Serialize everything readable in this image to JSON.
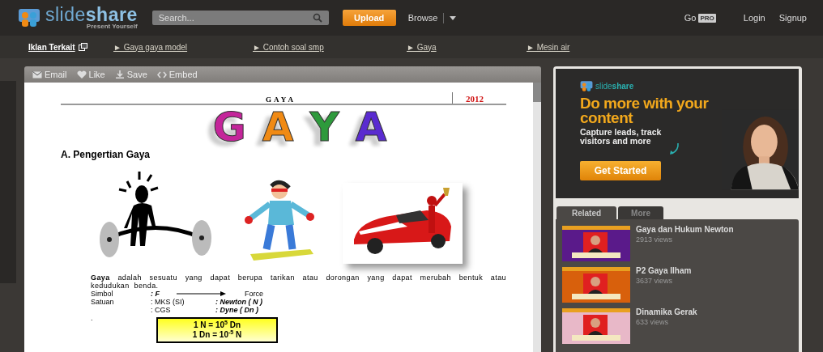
{
  "header": {
    "logo": {
      "part1": "slide",
      "part2": "share",
      "tagline": "Present Yourself"
    },
    "search": {
      "placeholder": "Search..."
    },
    "upload": "Upload",
    "browse": "Browse",
    "go": "Go",
    "pro": "PRO",
    "login": "Login",
    "signup": "Signup"
  },
  "ad_links": {
    "label": "Iklan Terkait",
    "links": [
      "► Gaya gaya model",
      "► Contoh soal smp",
      "► Gaya",
      "► Mesin air"
    ]
  },
  "toolbar": [
    "Email",
    "Like",
    "Save",
    "Embed"
  ],
  "slide": {
    "header": "GAYA",
    "year": "2012",
    "big_title": [
      {
        "char": "G",
        "color": "#c4259a"
      },
      {
        "char": "A",
        "color": "#f08a14"
      },
      {
        "char": "Y",
        "color": "#2e9a3c"
      },
      {
        "char": "A",
        "color": "#5a2bd0"
      }
    ],
    "heading": "A. Pengertian Gaya",
    "paragraph": "**Gaya** adalah sesuatu yang dapat berupa tarikan atau dorongan yang dapat merubah bentuk atau kedudukan benda.",
    "rows": [
      {
        "label": "Simbol",
        "value": ": F",
        "kind": "arrow",
        "result": "Force"
      },
      {
        "label": "Satuan",
        "value": ": MKS (SI)",
        "kind": "colon",
        "result": ": Newton ( N )"
      },
      {
        "label": "",
        "value": ": CGS",
        "kind": "colon",
        "result": ": Dyne ( Dn )"
      }
    ],
    "dot": ".",
    "formula": [
      "1 N = 10$^{5}$ Dn",
      "1 Dn = 10$^{-5}$ N"
    ]
  },
  "ad": {
    "brand1": "slide",
    "brand2": "share",
    "headline": "Do more with your content",
    "text": "Capture leads, track visitors and more",
    "button": "Get Started"
  },
  "tabs": [
    {
      "label": "Related",
      "selected": true
    },
    {
      "label": "More",
      "selected": false
    }
  ],
  "related": [
    {
      "title": "Gaya dan Hukum Newton",
      "views": "2913 views"
    },
    {
      "title": "P2 Gaya Ilham",
      "views": "3637 views"
    },
    {
      "title": "Dinamika Gerak",
      "views": "633 views"
    }
  ]
}
